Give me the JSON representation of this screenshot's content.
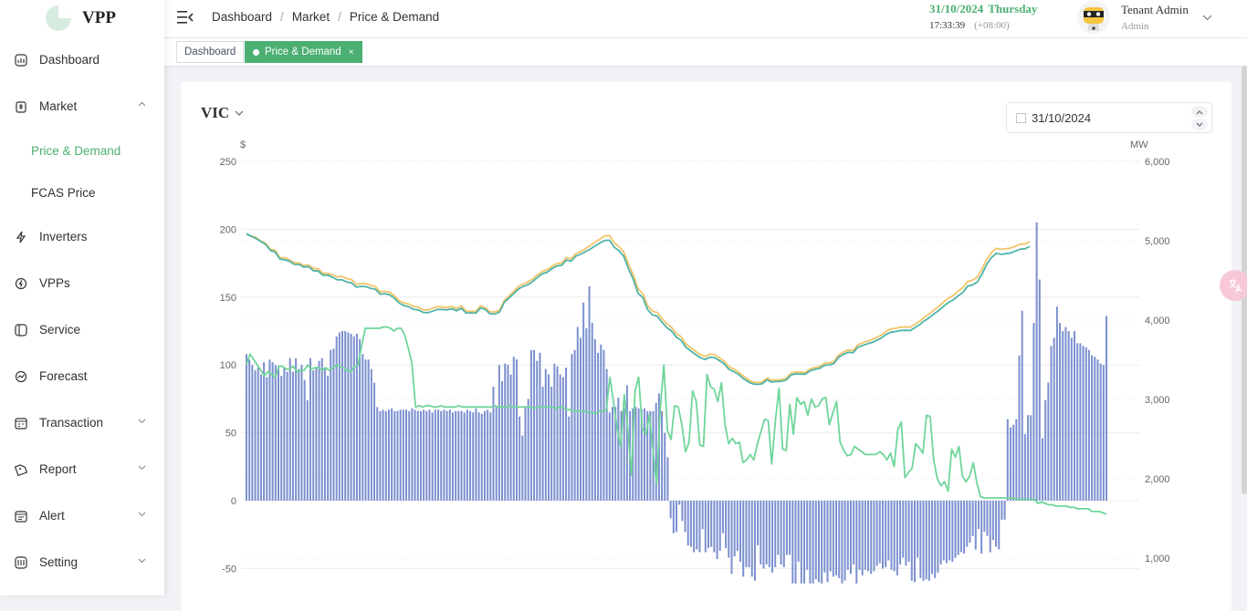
{
  "app": {
    "name": "VPP"
  },
  "sidebar": {
    "items": [
      {
        "label": "Dashboard",
        "icon": "dashboard-icon"
      },
      {
        "label": "Market",
        "icon": "market-icon",
        "expanded": true,
        "children": [
          {
            "label": "Price & Demand",
            "active": true
          },
          {
            "label": "FCAS Price"
          }
        ]
      },
      {
        "label": "Inverters",
        "icon": "bolt-icon"
      },
      {
        "label": "VPPs",
        "icon": "vpp-icon"
      },
      {
        "label": "Service",
        "icon": "service-icon"
      },
      {
        "label": "Forecast",
        "icon": "forecast-icon"
      },
      {
        "label": "Transaction",
        "icon": "transaction-icon",
        "has_children": true
      },
      {
        "label": "Report",
        "icon": "report-icon",
        "has_children": true
      },
      {
        "label": "Alert",
        "icon": "alert-icon",
        "has_children": true
      },
      {
        "label": "Setting",
        "icon": "setting-icon",
        "has_children": true
      }
    ]
  },
  "header": {
    "breadcrumb": [
      "Dashboard",
      "Market",
      "Price & Demand"
    ],
    "date": "31/10/2024",
    "weekday": "Thursday",
    "time": "17:33:39",
    "timezone": "(+08:00)",
    "user_name": "Tenant Admin",
    "user_role": "Admin"
  },
  "tags": [
    {
      "label": "Dashboard",
      "active": false
    },
    {
      "label": "Price & Demand",
      "active": true,
      "close": "×"
    }
  ],
  "page": {
    "region": "VIC",
    "date_value": "31/10/2024"
  },
  "colors": {
    "accent": "#4caf72",
    "bar": "#7b8fcf",
    "price_line": "#6fd59a",
    "demand_forecast": "#f2c466",
    "demand_actual": "#4fb3a9"
  },
  "chart_data": {
    "type": "bar",
    "title": "",
    "ylabel": "$",
    "y2label": "MW",
    "ylim": [
      -50,
      250
    ],
    "y2lim": [
      1000,
      6000
    ],
    "yticks": [
      -50,
      0,
      50,
      100,
      150,
      200,
      250
    ],
    "y2ticks": [
      "1,000",
      "2,000",
      "3,000",
      "4,000",
      "5,000",
      "6,000"
    ],
    "series": [
      {
        "name": "",
        "type": "bar",
        "axis": "left",
        "values": [
          108,
          104,
          100,
          96,
          98,
          93,
          102,
          91,
          104,
          102,
          100,
          99,
          92,
          98,
          95,
          105,
          95,
          105,
          97,
          100,
          89,
          74,
          105,
          96,
          98,
          103,
          105,
          97,
          92,
          111,
          112,
          121,
          124,
          125,
          125,
          124,
          123,
          121,
          123,
          119,
          108,
          104,
          104,
          97,
          87,
          69,
          66,
          67,
          66,
          67,
          68,
          66,
          66,
          67,
          67,
          67,
          66,
          68,
          67,
          66,
          66,
          67,
          66,
          67,
          65,
          67,
          67,
          66,
          67,
          66,
          67,
          65,
          66,
          66,
          66,
          65,
          67,
          66,
          65,
          68,
          65,
          64,
          66,
          67,
          65,
          84,
          69,
          100,
          88,
          101,
          100,
          93,
          106,
          104,
          62,
          48,
          69,
          75,
          111,
          111,
          103,
          109,
          84,
          97,
          93,
          84,
          101,
          99,
          93,
          91,
          98,
          62,
          108,
          111,
          128,
          120,
          146,
          127,
          158,
          131,
          119,
          109,
          115,
          111,
          97,
          65,
          69,
          69,
          76,
          66,
          68,
          85,
          66,
          68,
          69,
          68,
          67,
          68,
          66,
          66,
          66,
          72,
          79,
          66,
          50,
          32,
          -13,
          -24,
          -23,
          -3,
          -15,
          -23,
          -33,
          -34,
          -38,
          -36,
          -38,
          -21,
          -38,
          -35,
          -34,
          -38,
          -43,
          -37,
          -24,
          -35,
          -42,
          -54,
          -41,
          -37,
          -45,
          -56,
          -49,
          -49,
          -56,
          -59,
          -33,
          -47,
          -50,
          -47,
          -49,
          -53,
          -49,
          -40,
          -47,
          -49,
          -40,
          -40,
          -61,
          -61,
          -45,
          -61,
          -61,
          -51,
          -61,
          -61,
          -58,
          -60,
          -61,
          -53,
          -60,
          -52,
          -56,
          -55,
          -57,
          -61,
          -59,
          -51,
          -54,
          -47,
          -61,
          -51,
          -55,
          -51,
          -52,
          -54,
          -52,
          -48,
          -46,
          -50,
          -49,
          -44,
          -51,
          -52,
          -55,
          -47,
          -42,
          -48,
          -45,
          -59,
          -60,
          -42,
          -57,
          -59,
          -58,
          -59,
          -54,
          -57,
          -53,
          -47,
          -44,
          -46,
          -44,
          -45,
          -42,
          -40,
          -38,
          -39,
          -34,
          -31,
          -26,
          -36,
          -21,
          -39,
          -23,
          -26,
          -38,
          -29,
          -34,
          -36,
          -14,
          -14,
          60,
          54,
          56,
          60,
          107,
          140,
          49,
          63,
          63,
          131,
          205,
          163,
          46,
          74,
          87,
          114,
          120,
          143,
          131,
          125,
          128,
          125,
          120,
          125,
          116,
          116,
          114,
          113,
          111,
          107,
          106,
          104,
          101,
          100,
          136
        ]
      },
      {
        "name": "",
        "type": "line",
        "axis": "left",
        "values": [
          100,
          108,
          104,
          100,
          96,
          92,
          95,
          93,
          91,
          99,
          99,
          97,
          97,
          99,
          95,
          96,
          96,
          100,
          97,
          98,
          98,
          96,
          98,
          96,
          98,
          100,
          99,
          98,
          96,
          95,
          99,
          100,
          114,
          127,
          127,
          127,
          127,
          127,
          128,
          128,
          127,
          125,
          127,
          127,
          122,
          112,
          101,
          69,
          70,
          69,
          70,
          70,
          69,
          69,
          70,
          69,
          69,
          69,
          69,
          70,
          69,
          69,
          69,
          69,
          69,
          69,
          69,
          69,
          69,
          70,
          69,
          69,
          69,
          70,
          69,
          69,
          69,
          69,
          69,
          69,
          68,
          69,
          69,
          69,
          69,
          69,
          68,
          69,
          69,
          67,
          67,
          66,
          66,
          66,
          66,
          65,
          65,
          64,
          66,
          66,
          67,
          91,
          73,
          53,
          40,
          78,
          52,
          19,
          81,
          91,
          53,
          49,
          63,
          36,
          12,
          68,
          100,
          52,
          45,
          70,
          69,
          56,
          36,
          43,
          81,
          73,
          41,
          40,
          93,
          84,
          82,
          73,
          87,
          56,
          42,
          46,
          42,
          43,
          28,
          30,
          34,
          30,
          42,
          51,
          60,
          59,
          27,
          59,
          83,
          38,
          37,
          71,
          49,
          76,
          71,
          73,
          63,
          75,
          69,
          70,
          75,
          76,
          56,
          65,
          73,
          43,
          37,
          33,
          34,
          40,
          38,
          36,
          34,
          34,
          34,
          34,
          36,
          34,
          30,
          35,
          25,
          52,
          58,
          17,
          21,
          24,
          42,
          39,
          35,
          63,
          62,
          30,
          16,
          11,
          14,
          7,
          38,
          32,
          40,
          18,
          14,
          18,
          28,
          13,
          3,
          2,
          2,
          2,
          2,
          2,
          2,
          2,
          2,
          2,
          1,
          1,
          1,
          1,
          1,
          1,
          -2,
          -1,
          -2,
          -3,
          -3,
          -4,
          -4,
          -4,
          -4,
          -5,
          -5,
          -6,
          -6,
          -6,
          -6,
          -8,
          -8,
          -8,
          -9,
          -10,
          -10,
          -10,
          -11,
          -11,
          -11,
          -12,
          -12,
          -12,
          -12,
          -13,
          -13,
          -13,
          -13,
          -13,
          -14,
          -14,
          -14,
          -14,
          -14,
          -14,
          -14,
          -14,
          -15,
          -15,
          -14,
          -14,
          -15,
          -15,
          -15,
          -15,
          -15,
          -15,
          -15,
          -16,
          -16,
          -16,
          -17,
          -17,
          -17,
          -17,
          -17,
          -17,
          -17,
          -17,
          -17,
          -17,
          -17,
          -17,
          -17,
          -17,
          -17,
          -17,
          -18,
          -18,
          -18,
          -18,
          -18,
          -18,
          -18,
          -18,
          -18,
          -18,
          -18,
          -18,
          -18,
          -18,
          -18,
          -18,
          -18,
          -18,
          -18,
          -18,
          -18,
          -18,
          -18,
          -18,
          -18,
          -18,
          -18,
          -18,
          -18,
          -18
        ]
      },
      {
        "name": "",
        "type": "line",
        "axis": "right",
        "values": [
          5079,
          5059,
          5043,
          4996,
          4970,
          4893,
          4881,
          4787,
          4786,
          4760,
          4725,
          4719,
          4687,
          4694,
          4650,
          4647,
          4590,
          4589,
          4572,
          4544,
          4552,
          4522,
          4512,
          4449,
          4461,
          4459,
          4438,
          4422,
          4355,
          4363,
          4349,
          4304,
          4244,
          4215,
          4202,
          4174,
          4161,
          4129,
          4127,
          4150,
          4169,
          4164,
          4156,
          4172,
          4142,
          4178,
          4111,
          4112,
          4108,
          4180,
          4157,
          4105,
          4102,
          4126,
          4250,
          4306,
          4366,
          4426,
          4457,
          4483,
          4522,
          4574,
          4617,
          4637,
          4678,
          4713,
          4720,
          4789,
          4774,
          4841,
          4864,
          4901,
          4941,
          4983,
          5021,
          5060,
          5065,
          4975,
          4927,
          4859,
          4706,
          4567,
          4391,
          4334,
          4180,
          4113,
          4097,
          4019,
          3954,
          3910,
          3831,
          3790,
          3701,
          3652,
          3609,
          3566,
          3540,
          3571,
          3564,
          3526,
          3486,
          3414,
          3384,
          3345,
          3296,
          3250,
          3220,
          3212,
          3220,
          3271,
          3242,
          3246,
          3250,
          3267,
          3331,
          3347,
          3342,
          3339,
          3383,
          3402,
          3414,
          3454,
          3461,
          3479,
          3560,
          3598,
          3624,
          3616,
          3687,
          3713,
          3734,
          3756,
          3783,
          3814,
          3863,
          3891,
          3897,
          3910,
          3914,
          3911,
          3949,
          3988,
          4038,
          4079,
          4130,
          4175,
          4229,
          4279,
          4311,
          4363,
          4408,
          4487,
          4503,
          4539,
          4640,
          4767,
          4851,
          4907,
          4891,
          4899,
          4908,
          4931,
          4956,
          4961,
          4989
        ]
      },
      {
        "name": "",
        "type": "line",
        "axis": "right",
        "values": [
          5091,
          5055,
          5028,
          4990,
          4954,
          4878,
          4856,
          4770,
          4760,
          4742,
          4702,
          4701,
          4668,
          4675,
          4623,
          4618,
          4566,
          4568,
          4541,
          4507,
          4508,
          4480,
          4470,
          4415,
          4425,
          4421,
          4401,
          4389,
          4326,
          4332,
          4317,
          4274,
          4213,
          4183,
          4168,
          4136,
          4128,
          4096,
          4094,
          4113,
          4134,
          4133,
          4128,
          4144,
          4117,
          4148,
          4087,
          4092,
          4087,
          4153,
          4133,
          4079,
          4076,
          4102,
          4225,
          4279,
          4337,
          4394,
          4425,
          4448,
          4490,
          4541,
          4586,
          4605,
          4650,
          4683,
          4692,
          4757,
          4744,
          4808,
          4831,
          4863,
          4897,
          4935,
          4971,
          5004,
          5007,
          4921,
          4874,
          4803,
          4648,
          4511,
          4337,
          4284,
          4130,
          4066,
          4050,
          3972,
          3906,
          3864,
          3785,
          3745,
          3659,
          3612,
          3569,
          3528,
          3503,
          3531,
          3528,
          3491,
          3450,
          3381,
          3352,
          3315,
          3266,
          3224,
          3196,
          3189,
          3198,
          3246,
          3219,
          3225,
          3229,
          3245,
          3307,
          3323,
          3320,
          3318,
          3360,
          3379,
          3391,
          3429,
          3437,
          3453,
          3532,
          3569,
          3595,
          3587,
          3657,
          3681,
          3700,
          3719,
          3746,
          3777,
          3822,
          3848,
          3856,
          3869,
          3871,
          3868,
          3907,
          3945,
          3993,
          4032,
          4081,
          4124,
          4175,
          4224,
          4255,
          4306,
          4349,
          4428,
          4443,
          4478,
          4578,
          4703,
          4788,
          4843,
          4829,
          4837,
          4846,
          4870,
          4893,
          4899,
          4926
        ]
      }
    ]
  }
}
